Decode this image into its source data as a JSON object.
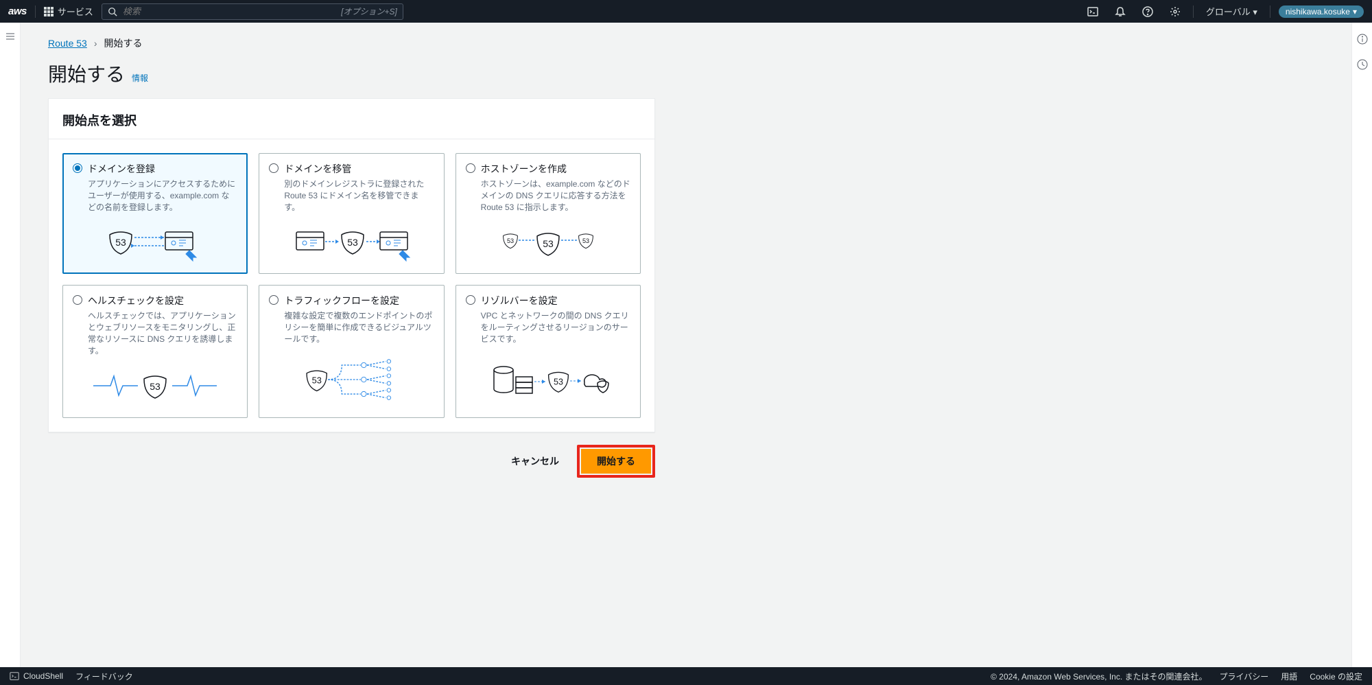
{
  "topnav": {
    "logo": "aws",
    "services": "サービス",
    "search_placeholder": "検索",
    "search_shortcut": "[オプション+S]",
    "region": "グローバル",
    "user": "nishikawa.kosuke"
  },
  "breadcrumb": {
    "root": "Route 53",
    "current": "開始する"
  },
  "heading": {
    "title": "開始する",
    "info": "情報"
  },
  "panel": {
    "title": "開始点を選択"
  },
  "options": [
    {
      "id": "register-domain",
      "title": "ドメインを登録",
      "desc": "アプリケーションにアクセスするためにユーザーが使用する、example.com などの名前を登録します。",
      "selected": true
    },
    {
      "id": "transfer-domain",
      "title": "ドメインを移管",
      "desc": "別のドメインレジストラに登録された Route 53 にドメイン名を移管できます。",
      "selected": false
    },
    {
      "id": "create-hosted-zone",
      "title": "ホストゾーンを作成",
      "desc": "ホストゾーンは、example.com などのドメインの DNS クエリに応答する方法を Route 53 に指示します。",
      "selected": false
    },
    {
      "id": "configure-health-check",
      "title": "ヘルスチェックを設定",
      "desc": "ヘルスチェックでは、アプリケーションとウェブリソースをモニタリングし、正常なリソースに DNS クエリを誘導します。",
      "selected": false
    },
    {
      "id": "configure-traffic-flow",
      "title": "トラフィックフローを設定",
      "desc": "複雑な設定で複数のエンドポイントのポリシーを簡単に作成できるビジュアルツールです。",
      "selected": false
    },
    {
      "id": "configure-resolver",
      "title": "リゾルバーを設定",
      "desc": "VPC とネットワークの間の DNS クエリをルーティングさせるリージョンのサービスです。",
      "selected": false
    }
  ],
  "actions": {
    "cancel": "キャンセル",
    "start": "開始する"
  },
  "footer": {
    "cloudshell": "CloudShell",
    "feedback": "フィードバック",
    "copyright": "© 2024, Amazon Web Services, Inc. またはその関連会社。",
    "privacy": "プライバシー",
    "terms": "用語",
    "cookie": "Cookie の設定"
  }
}
